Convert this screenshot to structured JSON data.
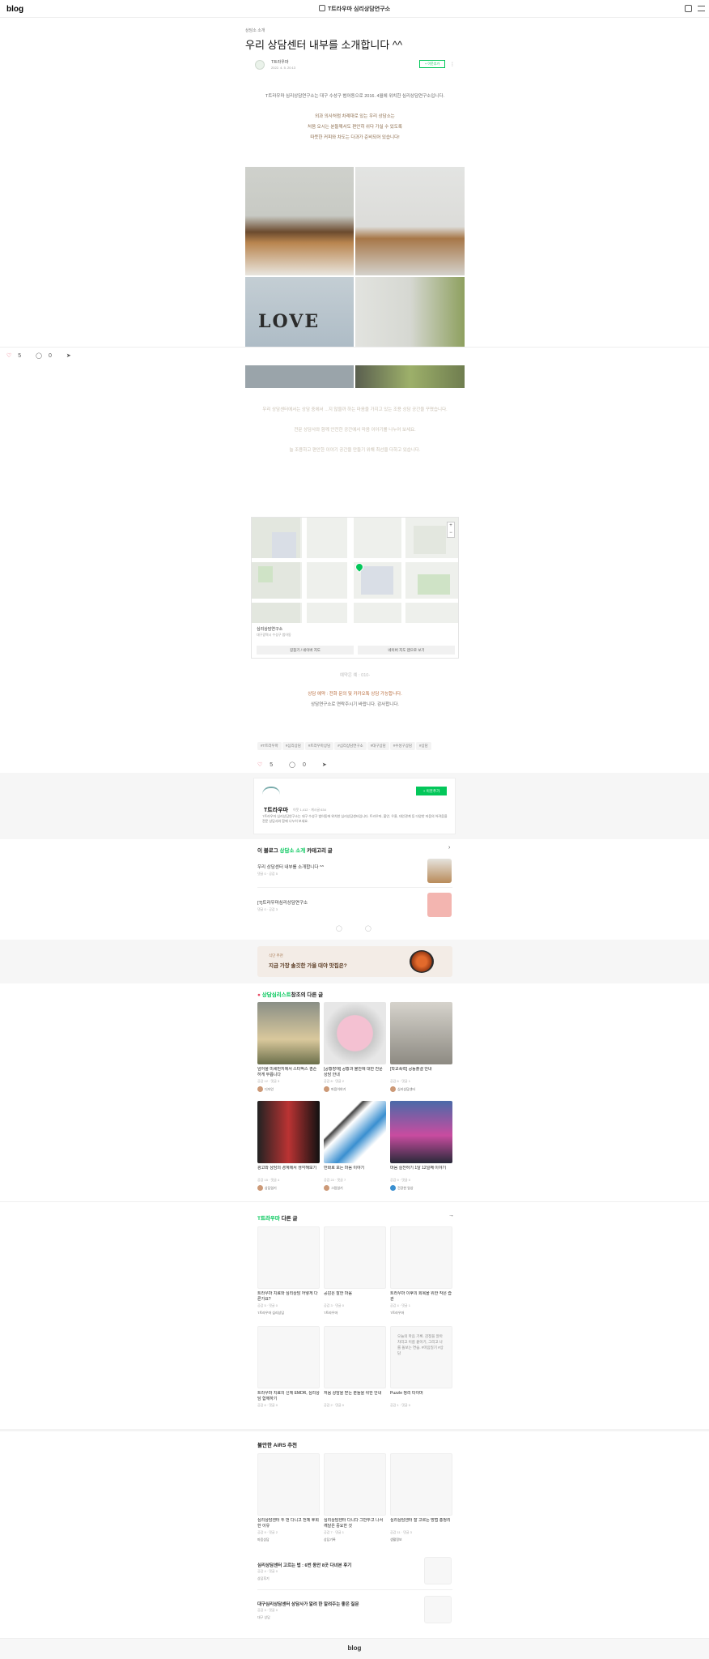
{
  "header": {
    "logo": "blog",
    "blog_name": "T트라우마 심리상담연구소",
    "icons": [
      "write-icon",
      "menu-icon"
    ]
  },
  "post": {
    "category": "상담소 소개",
    "title": "우리 상담센터 내부를 소개합니다 ^^",
    "author": "T트라우마",
    "date": "2022. 4. 5. 20:13",
    "follow_label": "+ 이웃추가",
    "paragraphs": [
      "T트라우마 심리상담연구소는 대구 수성구 범어동으로 2016. 4월에 위치한 심리상담연구소입니다.",
      "외과 의사처럼 차례대로 있는 우리 상담소는",
      "처음 오시는 분들께서도 편안히 쉬다 가실 수 있도록",
      "따뜻한 커피와 차도는 다과가 준비되어 있습니다!"
    ],
    "faded_paragraphs": [
      "우리 상담센터에서는 상담 중에서 ...지 않을까 하는 마음을 가지고 있는 조용 상담 공간을 꾸몄습니다.",
      "전문 상담사와 함께 안전한 공간에서 마음 이야기를 나누어 보세요.",
      "늘 조용하고 편안한 이야기 공간을 만들기 위해 최선을 다하고 있습니다."
    ],
    "photo_label": "LOVE",
    "like_count": "5",
    "comment_count": "0"
  },
  "map": {
    "place_name": "심리상담연구소",
    "address": "대구광역시 수성구 범어동",
    "zoom_in": "+",
    "zoom_out": "−",
    "buttons": [
      "길찾기 / 네이버 지도",
      "네이버 지도 앱으로 보기"
    ]
  },
  "contact": {
    "line1": "예약은 예 : 010-",
    "line2": "상담 예약 : 전화 문의 및 카카오톡 상담 가능합니다.",
    "line3": "상담연구소로 연락주시기 바랍니다. 감사합니다."
  },
  "tags": [
    "#T트라우마",
    "#심리상담",
    "#트라우마상담",
    "#심리상담연구소",
    "#대구상담",
    "#수성구상담",
    "#상담"
  ],
  "bottom_actions": {
    "like_count": "5",
    "comment_count": "0"
  },
  "profile": {
    "name": "T트라우마",
    "stats": "이웃 1,412 · 게시글 634",
    "desc": "T트라우마 심리상담연구소는 대구 수성구 범어동에 위치한 심리상담센터입니다. 트라우마, 불안, 우울, 대인관계 등 다양한 마음의 어려움을 전문 상담사와 함께 나누어 보세요.",
    "follow_label": "+ 이웃추가"
  },
  "category_list": {
    "heading_pre": "이 블로그",
    "heading_cat": "상담소 소개",
    "heading_post": "카테고리 글",
    "items": [
      {
        "title": "우리 상담센터 내부를 소개합니다 ^^",
        "meta": "댓글 0 · 공감 5"
      },
      {
        "title": "[T]트라우마심리상담연구소",
        "meta": "댓글 0 · 공감 3"
      }
    ]
  },
  "banner": {
    "small": "식단 추천",
    "large": "지금 가장 솔깃한 가을 대야 맛집은?"
  },
  "topic_posts": {
    "heading_pre": "상담심리스트",
    "heading_post": "창조의 다른 글",
    "items": [
      {
        "title": "넘어올 미세먼지에서 스타벅스 겸손하게 부릅니다",
        "meta": "공감 12 · 댓글 3",
        "author": "디자인"
      },
      {
        "title": "[공황장애] 공황과 불안에 대한 전문상담 안내",
        "meta": "공감 8 · 댓글 2",
        "author": "마음이야기"
      },
      {
        "title": "[학교폭력] 공동출결 안내",
        "meta": "공감 6 · 댓글 1",
        "author": "심리상담센터"
      },
      {
        "title": "광고와 상담의 경계에서 생각해보기",
        "meta": "공감 15 · 댓글 4",
        "author": "상담일기"
      },
      {
        "title": "만화로 보는 마음 이야기",
        "meta": "공감 22 · 댓글 7",
        "author": "그림일기"
      },
      {
        "title": "마음 실천하기 1달 12일째 이야기",
        "meta": "공감 9 · 댓글 0",
        "author": "건강한 일상"
      }
    ]
  },
  "other_posts": {
    "heading_pre": "T트라우마",
    "heading_post": "다른 글",
    "items": [
      {
        "title": "트라우마 치료와 심리상담 어떻게 다른가요?",
        "meta": "공감 5 · 댓글 0",
        "author": "T트라우마 심리상담"
      },
      {
        "title": "공감은 잘한 마음",
        "meta": "공감 3 · 댓글 0",
        "author": "T트라우마"
      },
      {
        "title": "트라우마 이후의 회복을 위한 작은 습관",
        "meta": "공감 4 · 댓글 1",
        "author": "T트라우마"
      },
      {
        "title": "트라우마 치료의 신체 EMDR, 심리상담 함께하기",
        "meta": "공감 6 · 댓글 0",
        "author": "T트라우마"
      },
      {
        "title": "처음 상담을 받는 분들을 위한 안내",
        "meta": "공감 2 · 댓글 0",
        "author": "T트라우마"
      },
      {
        "title": "Puzzle 정리 타이머",
        "meta": "공감 1 · 댓글 0",
        "author": "T트라우마"
      }
    ],
    "text_thumb": "오늘의 마음 기록. 감정을 알아차리고 이름 붙이기, 그리고 나를 돌보는 연습. #마음일기 #상담"
  },
  "airs": {
    "heading": "불안한 AiRS 추천",
    "items": [
      {
        "title": "심리상담센터 두 번 다니고 전체 후회한 이유",
        "meta": "공감 9 · 댓글 2",
        "author": "마음상담"
      },
      {
        "title": "심리상담센터 다니다 그만두고 나서 깨달은 중요한 것",
        "meta": "공감 7 · 댓글 1",
        "author": "상담기록"
      },
      {
        "title": "심리상담센터 잘 고르는 방법 총정리",
        "meta": "공감 11 · 댓글 3",
        "author": "생활정보"
      }
    ],
    "list": [
      {
        "title": "심리상담센터 고르는 법 : 6번 동안 8곳 다녀본 후기",
        "meta": "공감 4 · 댓글 0",
        "author": "상담후기"
      },
      {
        "title": "대구심리상담센터 상담사가 알려 한 알려주는 좋은 질문",
        "meta": "공감 3 · 댓글 0",
        "author": "대구 상담"
      }
    ]
  },
  "footer": {
    "logo": "blog"
  },
  "colors": {
    "accent": "#03c75a",
    "like": "#e8455f"
  }
}
